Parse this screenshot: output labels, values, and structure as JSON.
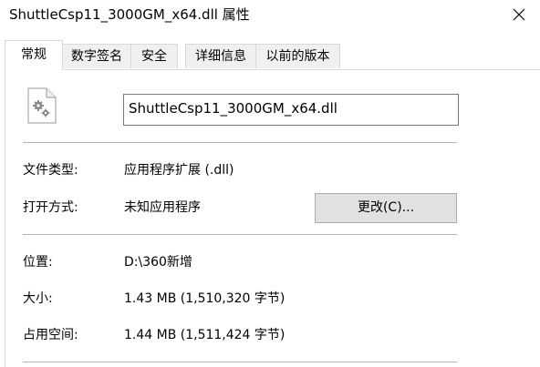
{
  "window": {
    "title": "ShuttleCsp11_3000GM_x64.dll 属性"
  },
  "tabs": [
    {
      "label": "常规"
    },
    {
      "label": "数字签名"
    },
    {
      "label": "安全"
    },
    {
      "label": "详细信息"
    },
    {
      "label": "以前的版本"
    }
  ],
  "general": {
    "filename": "ShuttleCsp11_3000GM_x64.dll",
    "file_icon": "dll-file-gear-icon",
    "file_type_label": "文件类型:",
    "file_type_value": "应用程序扩展 (.dll)",
    "opens_with_label": "打开方式:",
    "opens_with_value": "未知应用程序",
    "change_button_label": "更改(C)...",
    "location_label": "位置:",
    "location_value": "D:\\360新增",
    "size_label": "大小:",
    "size_value": "1.43 MB (1,510,320 字节)",
    "size_on_disk_label": "占用空间:",
    "size_on_disk_value": "1.44 MB (1,511,424 字节)"
  },
  "colors": {
    "button_bg": "#e1e1e1",
    "border": "#d9d9d9",
    "separator": "#b5b5b5"
  }
}
